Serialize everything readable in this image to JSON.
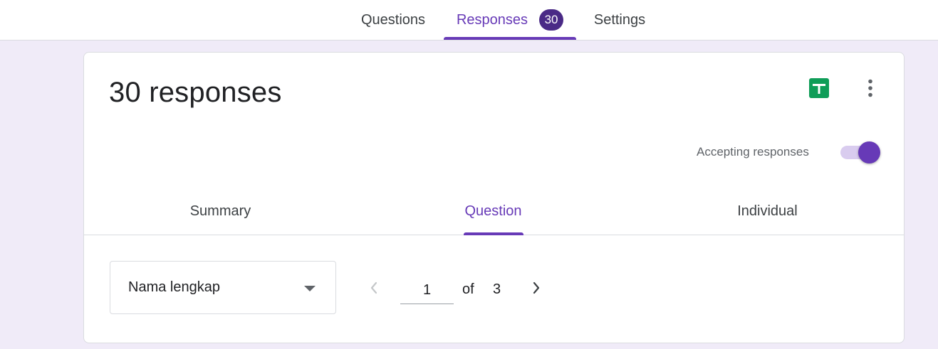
{
  "top_tabs": {
    "questions": "Questions",
    "responses": "Responses",
    "responses_badge": "30",
    "settings": "Settings"
  },
  "summary": {
    "title": "30 responses",
    "accepting_label": "Accepting responses",
    "accepting_on": true
  },
  "sub_tabs": {
    "summary": "Summary",
    "question": "Question",
    "individual": "Individual"
  },
  "question_view": {
    "selected_question": "Nama lengkap",
    "current_page": "1",
    "of_label": "of",
    "total_pages": "3"
  },
  "icons": {
    "sheets": "google-sheets-icon",
    "more": "more-vert-icon",
    "dropdown": "arrow-drop-down-icon",
    "prev": "chevron-left-icon",
    "next": "chevron-right-icon"
  },
  "colors": {
    "accent": "#673ab7",
    "badge": "#4a2a86",
    "background": "#f0ebf8",
    "sheets_green": "#0f9d58"
  }
}
